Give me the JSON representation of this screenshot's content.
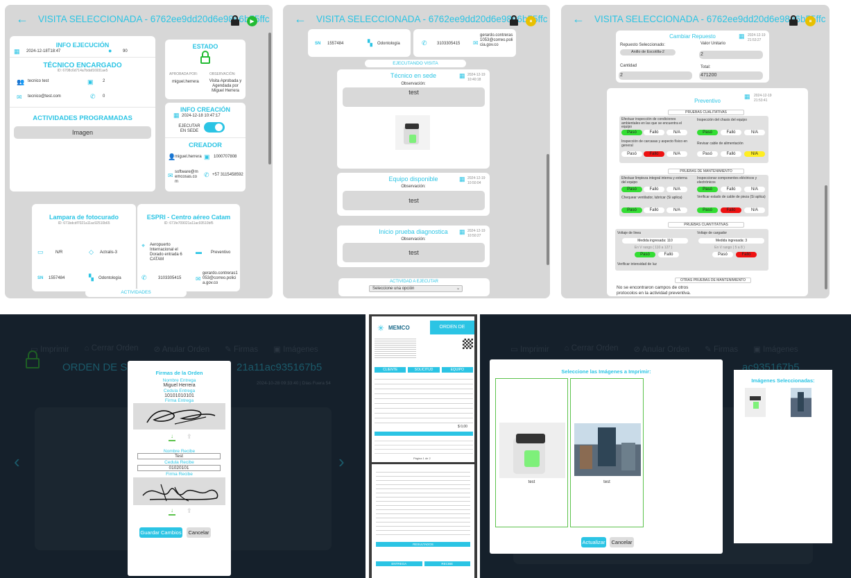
{
  "common": {
    "title": "VISITA SELECCIONADA - 6762ee9dd20d6e98e6b55ffc",
    "back_icon": "arrow-left-icon",
    "lock_icon": "lock-icon",
    "accent": "#2bc4e4"
  },
  "p1": {
    "info": {
      "title": "INFO EJECUCIÓN",
      "date": "2024-12-18T18:47",
      "count": "90"
    },
    "tecnico": {
      "title": "TÉCNICO ENCARGADO",
      "id": "ID: 6708c6d714a7bdaf16931ae5",
      "name": "tecnico test",
      "count": "2",
      "email": "tecnico@test.com",
      "phone": "0"
    },
    "actividades": {
      "title": "ACTIVIDADES PROGRAMADAS",
      "button": "Imagen"
    },
    "estado": {
      "title": "ESTADO",
      "aprobada_label": "APROBADA POR:",
      "aprobada_value": "miguel.herrera",
      "obs_label": "OBSERVACIÓN:",
      "obs_value": "Visita Aprobada y Agendada por Miguel Herrera"
    },
    "creacion": {
      "title": "INFO CREACIÓN",
      "date": "2024-12-18 10:47:17",
      "toggle_label": "EJECUTAR EN SEDE"
    },
    "creador": {
      "title": "CREADOR",
      "user": "miguel.herrera",
      "doc": "1000707808",
      "email": "software@memcosas.com",
      "phone": "+57 3115458592"
    },
    "equipo": {
      "title": "Lampara de fotocurado",
      "id": "ID: 671bdcdf7021a11ac92510b65",
      "brand": "N/R",
      "model": "Actralis-3",
      "sn_label": "SN",
      "sn": "1557484",
      "area": "Odontología"
    },
    "cliente": {
      "title": "ESPRI - Centro aéreo Catam",
      "id": "ID: 671fe709021a11ac93510bf5",
      "address": "Aeropuerto Internacional el Dorado entrada 6 CATAM",
      "type": "Preventivo",
      "phone": "3103305415",
      "email": "gerardo.contreras1053@correo.policia.gov.co"
    },
    "bottom": "ACTIVIDADES"
  },
  "p2": {
    "sn_label": "SN",
    "sn": "1557484",
    "area": "Odontología",
    "phone": "3103305415",
    "email": "gerardo.contreras1053@correo.policia.gov.co",
    "status": "EJECUTANDO VISITA",
    "cards": [
      {
        "title": "Técnico en sede",
        "date": "2024-12-19 10:40:18",
        "obs_label": "Observación:",
        "obs": "test"
      },
      {
        "title": "Equipo disponible",
        "date": "2024-12-19 10:50:04",
        "obs_label": "Observación:",
        "obs": "test"
      },
      {
        "title": "Inicio prueba diagnostica",
        "date": "2024-12-19 10:50:27",
        "obs_label": "Observación:",
        "obs": "test"
      }
    ],
    "activity_label": "ACTIVIDAD A EJECUTAR",
    "select": "Seleccione una opción"
  },
  "p3": {
    "cambiar": {
      "title": "Cambiar Repuesto",
      "date": "2024-12-19 21:53:27",
      "rep_label": "Repuesto Seleccionado:",
      "rep_value": "Anillo de Escotilla-2",
      "vu_label": "Valor Unitario",
      "vu_value": "2",
      "cant_label": "Cantidad",
      "cant_value": "2",
      "total_label": "Total:",
      "total_value": "471200"
    },
    "prev": {
      "title": "Preventivo",
      "date": "2024-12-19 21:53:41",
      "sec1": "PRUEBAS CUALITATIVAS",
      "q1": "Efectuar inspección de condiciones ambientales en las que se encuentra el equipo",
      "q2": "Inspección del chasis del equipo",
      "q3": "Inspección de carcasas y aspecto físico en general",
      "q4": "Revisar cable de alimentación",
      "sec2": "PRUEBAS DE MANTENIMIENTO",
      "q5": "Efectuar limpieza integral interna y externa del equipo",
      "q6": "Inspeccionar componentes eléctricos y electrónicos",
      "q7": "Chequear ventilador, lubricar (Si aplica)",
      "q8": "Verificar estado de cable de pieza (Si aplica)",
      "sec3": "PRUEBAS CUANTITATIVAS",
      "v1": "Voltaje de linea",
      "v2": "Voltaje de cargador",
      "m1": "Medida ingresada: 110",
      "m2": "Medida ingresada: 3",
      "r1": "En V rango ( 110 a 127 )",
      "r2": "En V rango ( 5 a 8 )",
      "v3": "Verificar intensidad de luz",
      "sec4": "OTRAS PRUEBAS DE MANTENIMIENTO",
      "none": "No se encontraron campos de otros protocolos en la actividad preventiva.",
      "paso": "Pasó",
      "fallo": "Falló",
      "na": "N/A"
    }
  },
  "p4": {
    "toolbar": [
      "Imprimir",
      "Cerrar Orden",
      "Anular Orden",
      "Firmas",
      "Imágenes"
    ],
    "orden_left": "ORDEN DE S",
    "orden_right": "21a11ac935167b5",
    "date_line": "2024-10-28 09:33:40 | Días Fuera 54",
    "modal": {
      "title": "Firmas de la Orden",
      "entrega_label": "Nombre Entrega",
      "entrega_name": "Miguel Herrera",
      "ced_label": "Cedula Entrega",
      "ced_value": "10101010101",
      "firma_entrega": "Firma Entrega",
      "recibe_label": "Nombre Recibe",
      "recibe_name": "Test",
      "ced_r_label": "Cedula Recibe",
      "ced_r_value": "01020101",
      "firma_recibe": "Firma Recibe",
      "save": "Guardar Cambios",
      "cancel": "Cancelar"
    }
  },
  "p5": {
    "logo": "MEMCO",
    "title": "ORDEN DE SERVICIO",
    "cliente": "CLIENTE",
    "solicitud": "SOLICITUD",
    "equipo": "EQUIPO",
    "total": "$ 0,00",
    "resultados": "RESULTADOS",
    "entrega": "ENTREGA",
    "recibe": "RECIBE",
    "page": "Página 1 de 2"
  },
  "p6": {
    "toolbar": [
      "Imprimir",
      "Cerrar Orden",
      "Anular Orden",
      "Firmas",
      "Imágenes"
    ],
    "orden_right": "ac935167b5",
    "modal": {
      "title": "Seleccione las Imágenes a Imprimir:",
      "cap1": "test",
      "cap2": "test",
      "update": "Actualizar",
      "cancel": "Cancelar"
    },
    "side": {
      "title": "Imágenes Seleccionadas:"
    }
  }
}
